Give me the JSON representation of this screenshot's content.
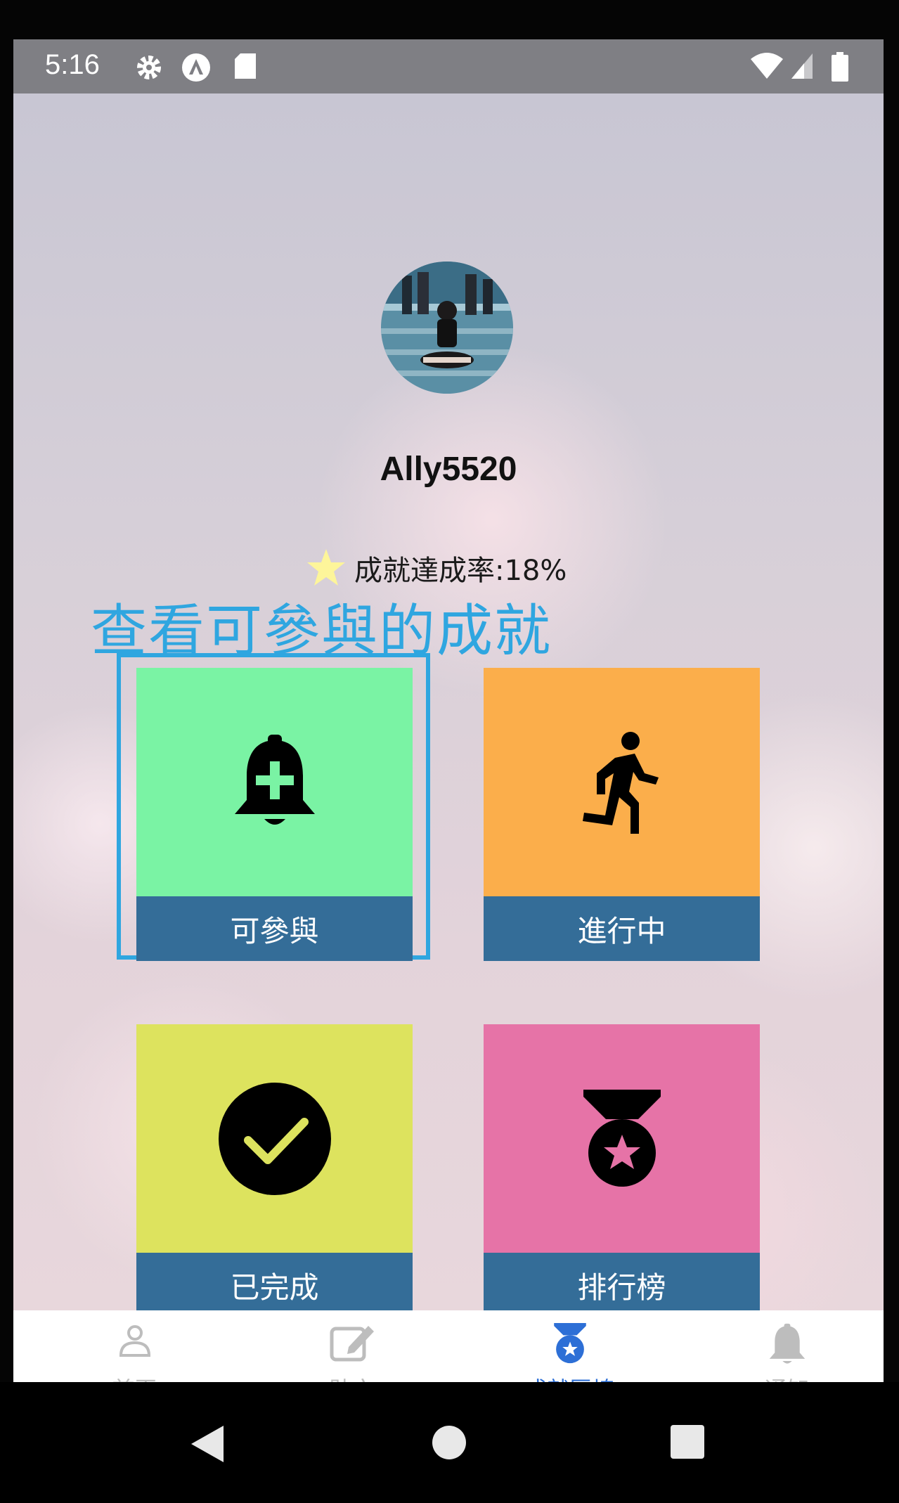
{
  "status_bar": {
    "time": "5:16",
    "icons": [
      "gear-icon",
      "app-icon",
      "sd-card-icon",
      "wifi-icon",
      "signal-icon",
      "battery-icon"
    ]
  },
  "profile": {
    "username": "Ally5520",
    "achievement_rate": "成就達成率:18%"
  },
  "annotation": {
    "text": "查看可參與的成就",
    "color": "#2fa6e0"
  },
  "tiles": [
    {
      "label": "可參與",
      "icon": "bell-plus-icon",
      "color": "#7af3a4"
    },
    {
      "label": "進行中",
      "icon": "running-icon",
      "color": "#fbae4b"
    },
    {
      "label": "已完成",
      "icon": "check-circle-icon",
      "color": "#dde35e"
    },
    {
      "label": "排行榜",
      "icon": "medal-icon",
      "color": "#e673a7"
    }
  ],
  "tabbar": {
    "tabs": [
      {
        "label": "首頁",
        "icon": "person-icon",
        "active": false
      },
      {
        "label": "貼文",
        "icon": "edit-icon",
        "active": false
      },
      {
        "label": "成就區塊",
        "icon": "medal-icon",
        "active": true
      },
      {
        "label": "通知",
        "icon": "bell-icon",
        "active": false
      }
    ],
    "active_color": "#2d6fd6"
  },
  "colors": {
    "label_bar": "#346d98",
    "status_bar": "#7f7f84"
  }
}
